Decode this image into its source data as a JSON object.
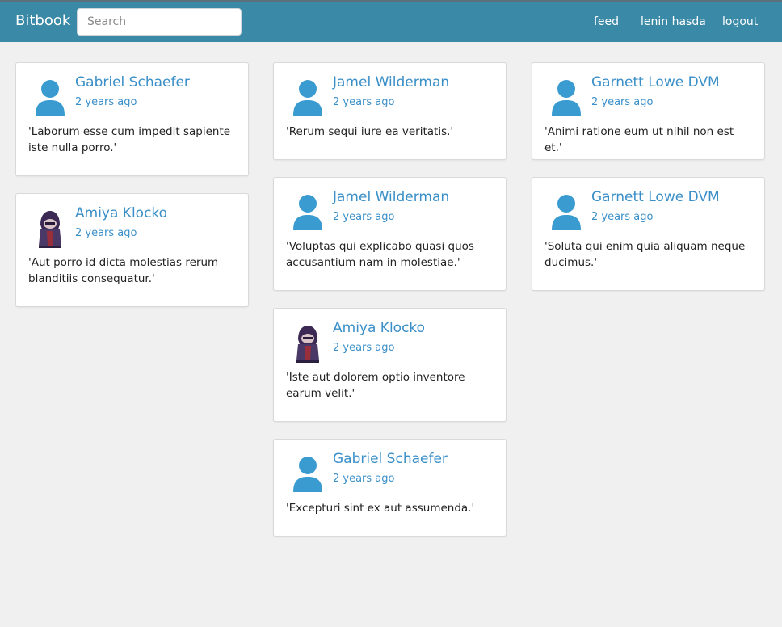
{
  "navbar": {
    "brand": "Bitbook",
    "search_placeholder": "Search",
    "links": [
      "feed",
      "lenin hasda",
      "logout"
    ]
  },
  "posts": [
    {
      "author": "Gabriel Schaefer",
      "time": "2 years ago",
      "text": "'Laborum esse cum impedit sapiente iste nulla porro.'",
      "avatar": "default-user-icon"
    },
    {
      "author": "Amiya Klocko",
      "time": "2 years ago",
      "text": "'Aut porro id dicta molestias rerum blanditiis consequatur.'",
      "avatar": "hooded-character-avatar"
    },
    {
      "author": "Jamel Wilderman",
      "time": "2 years ago",
      "text": "'Rerum sequi iure ea veritatis.'",
      "avatar": "default-user-icon"
    },
    {
      "author": "Jamel Wilderman",
      "time": "2 years ago",
      "text": "'Voluptas qui explicabo quasi quos accusantium nam in molestiae.'",
      "avatar": "default-user-icon"
    },
    {
      "author": "Amiya Klocko",
      "time": "2 years ago",
      "text": "'Iste aut dolorem optio inventore earum velit.'",
      "avatar": "hooded-character-avatar"
    },
    {
      "author": "Gabriel Schaefer",
      "time": "2 years ago",
      "text": "'Excepturi sint ex aut assumenda.'",
      "avatar": "default-user-icon"
    },
    {
      "author": "Garnett Lowe DVM",
      "time": "2 years ago",
      "text": "'Animi ratione eum ut nihil non est et.'",
      "avatar": "default-user-icon"
    },
    {
      "author": "Garnett Lowe DVM",
      "time": "2 years ago",
      "text": "'Soluta qui enim quia aliquam neque ducimus.'",
      "avatar": "default-user-icon"
    }
  ],
  "colors": {
    "navbar": "#3a89a7",
    "link": "#3a8fc8",
    "background": "#f0f0f0"
  }
}
